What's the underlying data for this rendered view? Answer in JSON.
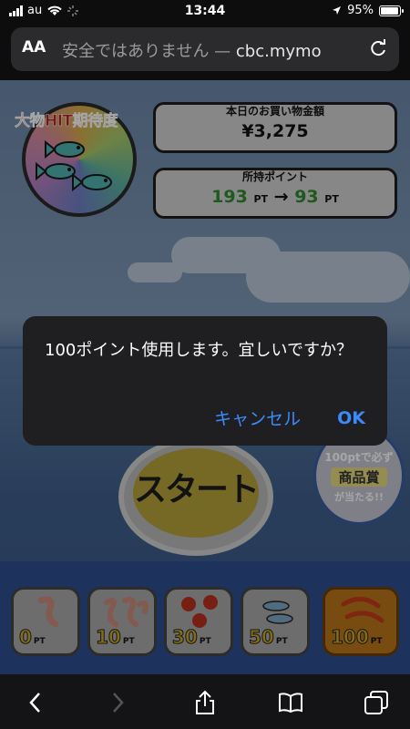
{
  "status_bar": {
    "carrier": "au",
    "time": "13:44",
    "battery": "95%"
  },
  "browser": {
    "aa_label": "AA",
    "url_security": "安全ではありません — ",
    "url_domain": "cbc.mymo"
  },
  "game": {
    "hit_label": "大物HIT期待度",
    "purchase": {
      "label": "本日のお買い物金額",
      "value": "¥3,275"
    },
    "points": {
      "label": "所持ポイント",
      "from": "193",
      "to": "93",
      "unit": "PT",
      "arrow": "→"
    },
    "start_label": "スタート",
    "promo": {
      "line1": "100ptで必ず",
      "line2": "商品賞",
      "line3": "が当たる!!"
    },
    "baits": [
      {
        "value": "0",
        "unit": "PT",
        "icon": "worm-icon"
      },
      {
        "value": "10",
        "unit": "PT",
        "icon": "worms-icon"
      },
      {
        "value": "30",
        "unit": "PT",
        "icon": "berries-icon"
      },
      {
        "value": "50",
        "unit": "PT",
        "icon": "small-fish-icon"
      },
      {
        "value": "100",
        "unit": "PT",
        "icon": "shrimp-icon",
        "selected": true
      }
    ]
  },
  "alert": {
    "message": "100ポイント使用します。宜しいですか？",
    "cancel": "キャンセル",
    "ok": "OK"
  },
  "colors": {
    "ios_blue": "#3d8aff",
    "points_green": "#2e8a2e",
    "selected_bait": "#b8761a"
  }
}
